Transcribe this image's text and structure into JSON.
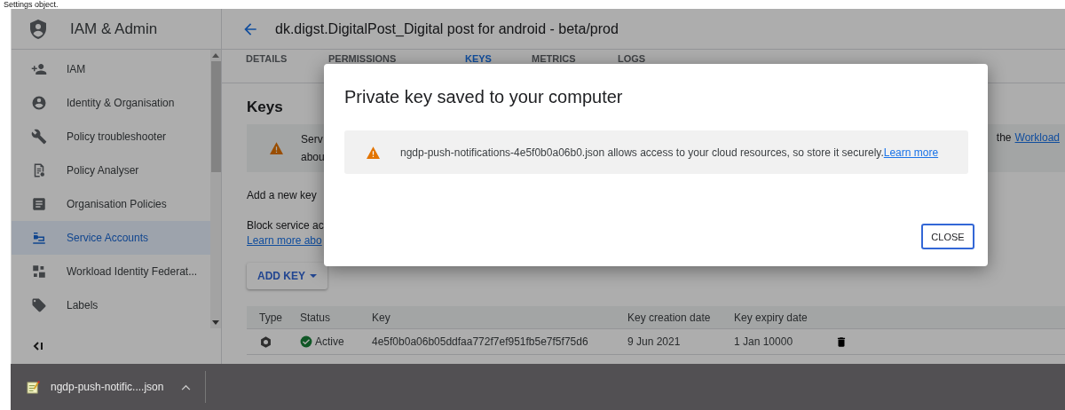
{
  "page_caption": "Settings object.",
  "app": {
    "title": "IAM & Admin",
    "page_title": "dk.digst.DigitalPost_Digital post for android - beta/prod"
  },
  "sidebar": {
    "items": [
      {
        "label": "IAM",
        "selected": false
      },
      {
        "label": "Identity & Organisation",
        "selected": false
      },
      {
        "label": "Policy troubleshooter",
        "selected": false
      },
      {
        "label": "Policy Analyser",
        "selected": false
      },
      {
        "label": "Organisation Policies",
        "selected": false
      },
      {
        "label": "Service Accounts",
        "selected": true
      },
      {
        "label": "Workload Identity Federat...",
        "selected": false
      },
      {
        "label": "Labels",
        "selected": false
      }
    ]
  },
  "tabs": [
    {
      "label": "DETAILS",
      "selected": false
    },
    {
      "label": "PERMISSIONS",
      "selected": false
    },
    {
      "label": "KEYS",
      "selected": true
    },
    {
      "label": "METRICS",
      "selected": false
    },
    {
      "label": "LOGS",
      "selected": false
    }
  ],
  "keys": {
    "heading": "Keys",
    "notice": {
      "lines": [
        "Serv",
        "abou"
      ],
      "right_text": "the",
      "right_link": "Workload"
    },
    "add_text": "Add a new key",
    "block_text": "Block service ac",
    "block_link": "Learn more abo",
    "add_button": "ADD KEY",
    "table": {
      "columns": [
        "Type",
        "Status",
        "Key",
        "Key creation date",
        "Key expiry date"
      ],
      "rows": [
        {
          "status": "Active",
          "key": "4e5f0b0a06b05ddfaa772f7ef951fb5e7f5f75d6",
          "created": "9 Jun 2021",
          "expires": "1 Jan 10000"
        }
      ]
    }
  },
  "dialog": {
    "title": "Private key saved to your computer",
    "message": "ngdp-push-notifications-4e5f0b0a06b0.json allows access to your cloud resources, so store it securely.",
    "link": "Learn more",
    "button": "CLOSE"
  },
  "download_bar": {
    "file": "ngdp-push-notific....json"
  }
}
